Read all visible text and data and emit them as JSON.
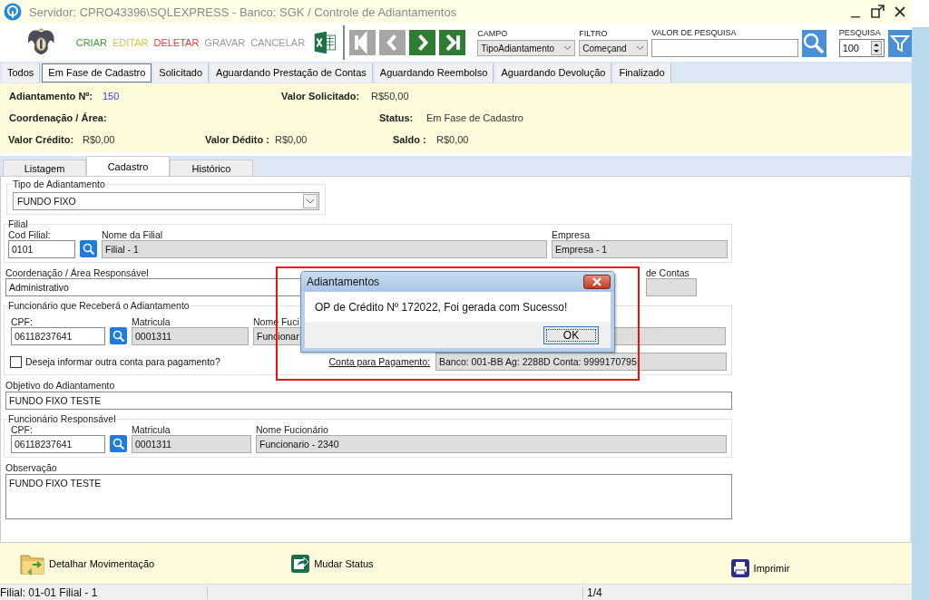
{
  "window": {
    "title": "Servidor: CPRO43396\\SQLEXPRESS - Banco: SGK / Controle de Adiantamentos"
  },
  "toolbar": {
    "actions": [
      {
        "label": "CRIAR",
        "color": "#3c9a3c"
      },
      {
        "label": "EDITAR",
        "color": "#d6c63c"
      },
      {
        "label": "DELETAR",
        "color": "#e23a3a"
      },
      {
        "label": "GRAVAR",
        "color": "#9a9a9a"
      },
      {
        "label": "CANCELAR",
        "color": "#9a9a9a"
      }
    ],
    "nav_buttons": [
      {
        "kind": "first",
        "disabled": true
      },
      {
        "kind": "prev",
        "disabled": true
      },
      {
        "kind": "next",
        "disabled": false
      },
      {
        "kind": "last",
        "disabled": false
      }
    ],
    "campo": {
      "label": "CAMPO",
      "value": "TipoAdiantamento"
    },
    "filtro": {
      "label": "FILTRO",
      "value": "Começand"
    },
    "valor": {
      "label": "VALOR DE PESQUISA"
    },
    "limite": {
      "label": "PESQUISA",
      "value": "100"
    }
  },
  "status_tabs": [
    {
      "label": "Todos",
      "selected": false
    },
    {
      "label": "Em Fase de Cadastro",
      "selected": true
    },
    {
      "label": "Solicitado",
      "selected": false
    },
    {
      "label": "Aguardando Prestação de Contas",
      "selected": false
    },
    {
      "label": "Aguardando Reembolso",
      "selected": false
    },
    {
      "label": "Aguardando Devolução",
      "selected": false
    },
    {
      "label": "Finalizado",
      "selected": false
    }
  ],
  "summary": {
    "numero_label": "Adiantamento Nº:",
    "numero": "150",
    "solicitado_label": "Valor Solicitado:",
    "solicitado": "R$50,00",
    "coordenacao_label": "Coordenação / Área:",
    "status_label": "Status:",
    "status": "Em Fase de Cadastro",
    "credito_label": "Valor Crédito:",
    "credito": "R$0,00",
    "debito_label": "Valor Dédito :",
    "debito": "R$0,00",
    "saldo_label": "Saldo :",
    "saldo": "R$0,00"
  },
  "form_tabs": [
    {
      "label": "Listagem",
      "selected": false
    },
    {
      "label": "Cadastro",
      "selected": true
    },
    {
      "label": "Histórico",
      "selected": false
    }
  ],
  "form": {
    "tipo": {
      "legend": "Tipo de Adiantamento",
      "value": "FUNDO FIXO"
    },
    "filial": {
      "legend": "Filial",
      "cod_label": "Cod Filial:",
      "cod_value": "0101",
      "nome_label": "Nome da Filial",
      "nome_value": "Filial - 1",
      "empresa_label": "Empresa",
      "empresa_value": "Empresa - 1"
    },
    "coordenacao": {
      "label": "Coordenação / Área Responsável",
      "value": "Administrativo",
      "right_label": "de Contas"
    },
    "funcionario": {
      "legend": "Funcionário que Receberá o Adiantamento",
      "cpf_label": "CPF:",
      "cpf_value": "06118237641",
      "matricula_label": "Matricula",
      "matricula_value": "0001311",
      "nome_label": "Nome Fuci",
      "nome_value": "Funcionar",
      "other_account": {
        "label": "Deseja informar outra conta para pagamento?",
        "checked": false
      },
      "conta_label": "Conta para Pagamento:",
      "conta_value": "Banco: 001-BB Ag: 2288D Conta: 9999170795"
    },
    "objetivo": {
      "label": "Objetivo do Adiantamento",
      "value": "FUNDO FIXO TESTE"
    },
    "responsavel": {
      "legend": "Funcionário Responsável",
      "cpf_label": "CPF:",
      "cpf_value": "06118237641",
      "matricula_label": "Matricula",
      "matricula_value": "0001311",
      "nome_label": "Nome Fucionário",
      "nome_value": "Funcionario - 2340"
    },
    "observacao": {
      "label": "Observação",
      "value": "FUNDO FIXO TESTE"
    }
  },
  "dialog": {
    "title": "Adiantamentos",
    "message": "OP de Crédito Nº 172022, Foi gerada com Sucesso!",
    "button": "OK"
  },
  "bottom_actions": [
    {
      "kind": "folder",
      "label": "Detalhar Movimentação"
    },
    {
      "kind": "status",
      "label": "Mudar Status"
    },
    {
      "kind": "print",
      "label": "Imprimir"
    }
  ],
  "status_bar": {
    "left": "Filial: 01-01 Filial - 1",
    "right": "1/4"
  }
}
